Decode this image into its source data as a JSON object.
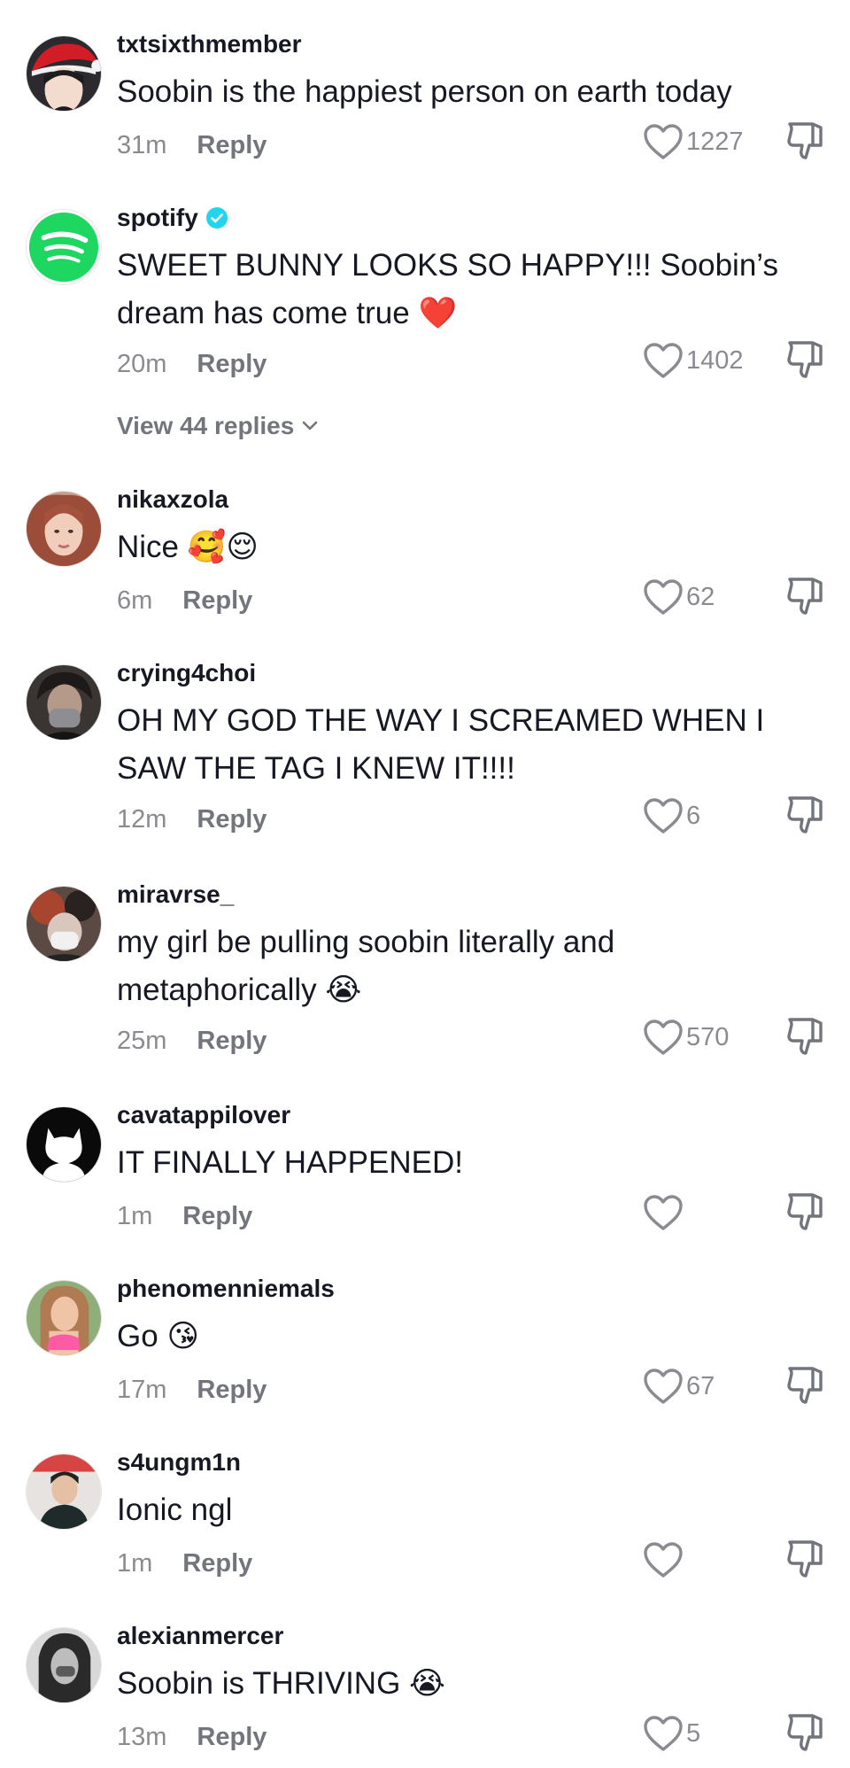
{
  "comments": [
    {
      "username": "txtsixthmember",
      "text": "Soobin is the happiest person on earth today",
      "emoji": "",
      "time": "31m",
      "reply": "Reply",
      "likes": "1227",
      "verified": false
    },
    {
      "username": "spotify",
      "text": "SWEET BUNNY LOOKS SO HAPPY!!! Soobin’s dream has come true",
      "emoji": "❤️",
      "time": "20m",
      "reply": "Reply",
      "likes": "1402",
      "verified": true,
      "view_replies": "View 44 replies"
    },
    {
      "username": "nikaxzola",
      "text": "Nice",
      "emoji": "🥰😌",
      "time": "6m",
      "reply": "Reply",
      "likes": "62",
      "verified": false
    },
    {
      "username": "crying4choi",
      "text": "OH MY GOD THE WAY I SCREAMED WHEN I SAW THE TAG I KNEW IT!!!!",
      "emoji": "",
      "time": "12m",
      "reply": "Reply",
      "likes": "6",
      "verified": false
    },
    {
      "username": "miravrse_",
      "text": "my girl be pulling soobin literally and metaphorically",
      "emoji": "😭",
      "time": "25m",
      "reply": "Reply",
      "likes": "570",
      "verified": false
    },
    {
      "username": "cavatappilover",
      "text": "IT FINALLY HAPPENED!",
      "emoji": "",
      "time": "1m",
      "reply": "Reply",
      "likes": "",
      "verified": false
    },
    {
      "username": "phenomenniemals",
      "text": "Go",
      "emoji": "😘",
      "time": "17m",
      "reply": "Reply",
      "likes": "67",
      "verified": false
    },
    {
      "username": "s4ungm1n",
      "text": "Ionic ngl",
      "emoji": "",
      "time": "1m",
      "reply": "Reply",
      "likes": "",
      "verified": false
    },
    {
      "username": "alexianmercer",
      "text": "Soobin is THRIVING",
      "emoji": "😭",
      "time": "13m",
      "reply": "Reply",
      "likes": "5",
      "verified": false
    }
  ],
  "icons": {
    "like": "heart-outline-icon",
    "dislike": "thumbs-down-icon",
    "verified": "verified-badge-icon",
    "expand": "chevron-down-icon"
  },
  "colors": {
    "text": "#161823",
    "secondary": "#8a8b91",
    "verified": "#20d5ec",
    "spotify": "#1ed760"
  }
}
